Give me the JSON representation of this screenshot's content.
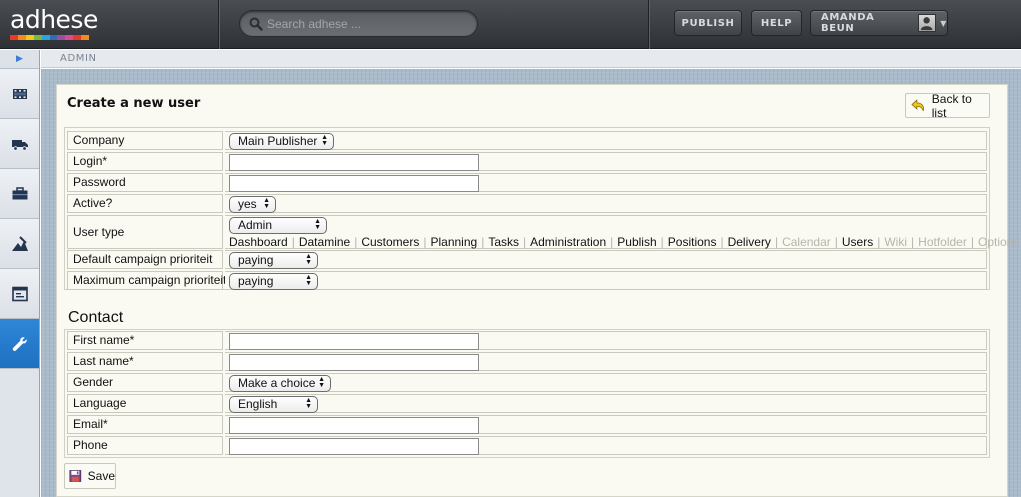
{
  "app": {
    "logo_text": "adhese",
    "logo_colors": [
      "#e8392b",
      "#f28a1e",
      "#f6c619",
      "#7ab940",
      "#2aa5d9",
      "#2e6db5",
      "#9c4ea0",
      "#e1498d",
      "#e8392b",
      "#f28a1e"
    ]
  },
  "header": {
    "search_placeholder": "Search adhese ...",
    "publish_label": "PUBLISH",
    "help_label": "HELP",
    "user_name": "AMANDA BEUN"
  },
  "breadcrumb": "ADMIN",
  "nav": {
    "items": [
      {
        "icon": "film-strip-icon",
        "active": false
      },
      {
        "icon": "truck-icon",
        "active": false
      },
      {
        "icon": "briefcase-icon",
        "active": false
      },
      {
        "icon": "chart-tool-icon",
        "active": false
      },
      {
        "icon": "window-panel-icon",
        "active": false
      },
      {
        "icon": "wrench-icon",
        "active": true
      }
    ]
  },
  "page": {
    "title": "Create a new user",
    "back_label": "Back to list",
    "save_label": "Save",
    "contact_heading": "Contact"
  },
  "user_form": {
    "company": {
      "label": "Company",
      "value": "Main Publisher"
    },
    "login": {
      "label": "Login*",
      "value": ""
    },
    "password": {
      "label": "Password",
      "value": ""
    },
    "active": {
      "label": "Active?",
      "value": "yes"
    },
    "user_type": {
      "label": "User type",
      "value": "Admin"
    },
    "permissions": [
      {
        "label": "Dashboard",
        "enabled": true
      },
      {
        "label": "Datamine",
        "enabled": true
      },
      {
        "label": "Customers",
        "enabled": true
      },
      {
        "label": "Planning",
        "enabled": true
      },
      {
        "label": "Tasks",
        "enabled": true
      },
      {
        "label": "Administration",
        "enabled": true
      },
      {
        "label": "Publish",
        "enabled": true
      },
      {
        "label": "Positions",
        "enabled": true
      },
      {
        "label": "Delivery",
        "enabled": true
      },
      {
        "label": "Calendar",
        "enabled": false
      },
      {
        "label": "Users",
        "enabled": true
      },
      {
        "label": "Wiki",
        "enabled": false
      },
      {
        "label": "Hotfolder",
        "enabled": false
      },
      {
        "label": "Options",
        "enabled": false
      }
    ],
    "default_priority": {
      "label": "Default campaign prioriteit",
      "value": "paying"
    },
    "max_priority": {
      "label": "Maximum campaign prioriteit",
      "value": "paying"
    }
  },
  "contact_form": {
    "first_name": {
      "label": "First name*",
      "value": ""
    },
    "last_name": {
      "label": "Last name*",
      "value": ""
    },
    "gender": {
      "label": "Gender",
      "value": "Make a choice"
    },
    "language": {
      "label": "Language",
      "value": "English"
    },
    "email": {
      "label": "Email*",
      "value": ""
    },
    "phone": {
      "label": "Phone",
      "value": ""
    }
  }
}
